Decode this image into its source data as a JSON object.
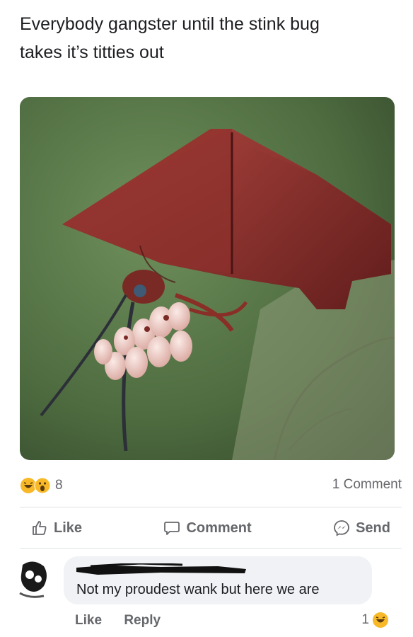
{
  "post": {
    "caption_line1": "Everybody gangster until the stink bug",
    "caption_line2": "takes it’s titties out",
    "image_alt_icon": "stink-bug-photo"
  },
  "stats": {
    "reaction_count": "8",
    "comment_count": "1 Comment",
    "reaction_icons": [
      "haha-emoji-icon",
      "wow-emoji-icon"
    ]
  },
  "actions": {
    "like": "Like",
    "comment": "Comment",
    "send": "Send"
  },
  "comment": {
    "text": "Not my proudest wank but here we are",
    "like": "Like",
    "reply": "Reply",
    "reaction_count": "1",
    "reaction_icon": "haha-emoji-icon"
  },
  "colors": {
    "secondary_text": "#65676b",
    "bubble_bg": "#f0f2f5",
    "reaction_yellow": "#f7b928"
  }
}
